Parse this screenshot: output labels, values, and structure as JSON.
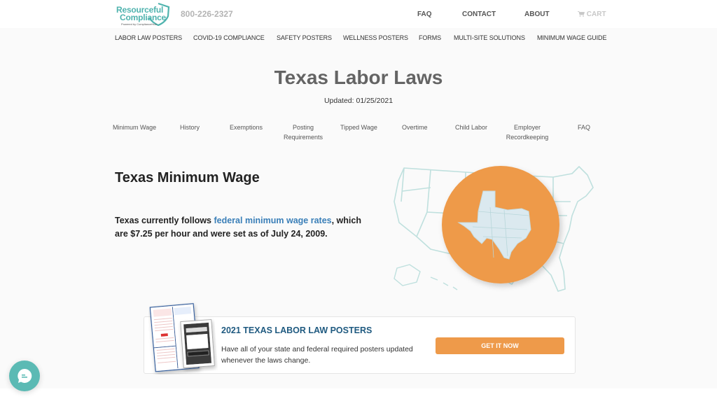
{
  "header": {
    "logo": {
      "line1": "Resourceful",
      "line2": "Compliance",
      "tagline": "Powered by ComplianceHub"
    },
    "phone": "800-226-2327",
    "top_nav": [
      {
        "label": "FAQ"
      },
      {
        "label": "CONTACT"
      },
      {
        "label": "ABOUT"
      },
      {
        "label": "CART",
        "icon": "cart-icon"
      }
    ],
    "sub_nav": [
      {
        "label": "LABOR LAW POSTERS"
      },
      {
        "label": "COVID-19 COMPLIANCE"
      },
      {
        "label": "SAFETY POSTERS"
      },
      {
        "label": "WELLNESS POSTERS"
      },
      {
        "label": "FORMS"
      },
      {
        "label": "MULTI-SITE SOLUTIONS"
      },
      {
        "label": "MINIMUM WAGE GUIDE"
      }
    ]
  },
  "page": {
    "title": "Texas Labor Laws",
    "updated": "Updated: 01/25/2021",
    "tabs": [
      {
        "label": "Minimum Wage"
      },
      {
        "label": "History"
      },
      {
        "label": "Exemptions"
      },
      {
        "label": "Posting Requirements"
      },
      {
        "label": "Tipped Wage"
      },
      {
        "label": "Overtime"
      },
      {
        "label": "Child Labor"
      },
      {
        "label": "Employer Recordkeeping"
      },
      {
        "label": "FAQ"
      }
    ]
  },
  "minimum_wage": {
    "title": "Texas Minimum Wage",
    "text_before": "Texas currently follows ",
    "link": "federal minimum wage rates",
    "text_after": ", which are $7.25 per hour and were set as of July 24, 2009.",
    "map_icon": "us-map-texas-highlight-icon"
  },
  "promo": {
    "title": "2021 TEXAS LABOR LAW POSTERS",
    "text": "Have all of your state and federal required posters updated whenever the laws change.",
    "button": "GET IT NOW",
    "image": "labor-law-posters-image"
  },
  "chat": {
    "icon": "chat-bubble-icon"
  },
  "colors": {
    "brand_teal": "#4fb3ae",
    "accent_orange": "#ee9a4a",
    "link_blue": "#3a7fb8",
    "promo_title_blue": "#1f5a80",
    "map_line": "#bfe0de"
  }
}
